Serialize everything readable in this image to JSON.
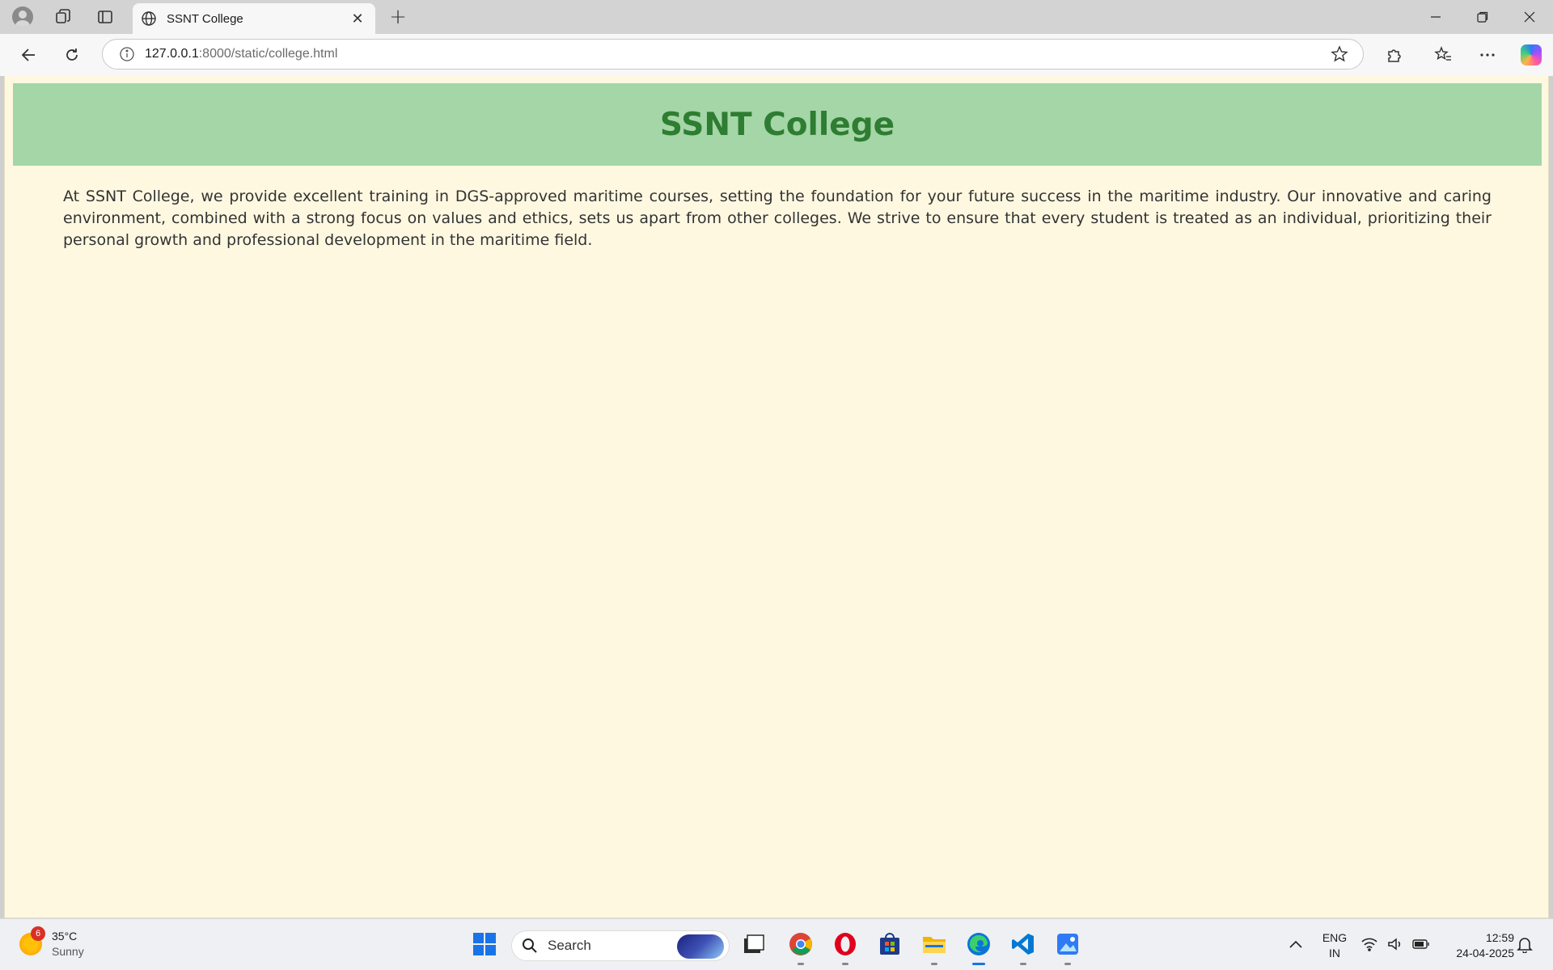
{
  "browser": {
    "tab": {
      "title": "SSNT College",
      "close_label": "✕"
    },
    "new_tab_label": "+",
    "address": {
      "host": "127.0.0.1",
      "rest": ":8000/static/college.html"
    }
  },
  "page": {
    "title": "SSNT College",
    "body": "At SSNT College, we provide excellent training in DGS-approved maritime courses, setting the foundation for your future success in the maritime industry. Our innovative and caring environment, combined with a strong focus on values and ethics, sets us apart from other colleges. We strive to ensure that every student is treated as an individual, prioritizing their personal growth and professional development in the maritime field.",
    "colors": {
      "background": "#fff8e1",
      "header_bg": "#a5d6a7",
      "title": "#2e7d32",
      "text": "#333333"
    }
  },
  "taskbar": {
    "weather": {
      "badge": "6",
      "temp": "35°C",
      "condition": "Sunny"
    },
    "search_placeholder": "Search",
    "apps": [
      "start-icon",
      "file-manager-icon",
      "chrome-icon",
      "opera-icon",
      "store-icon",
      "file-explorer-icon",
      "edge-icon",
      "vscode-icon",
      "photos-icon"
    ],
    "tray": {
      "lang_top": "ENG",
      "lang_bottom": "IN",
      "time": "12:59",
      "date": "24-04-2025"
    }
  }
}
